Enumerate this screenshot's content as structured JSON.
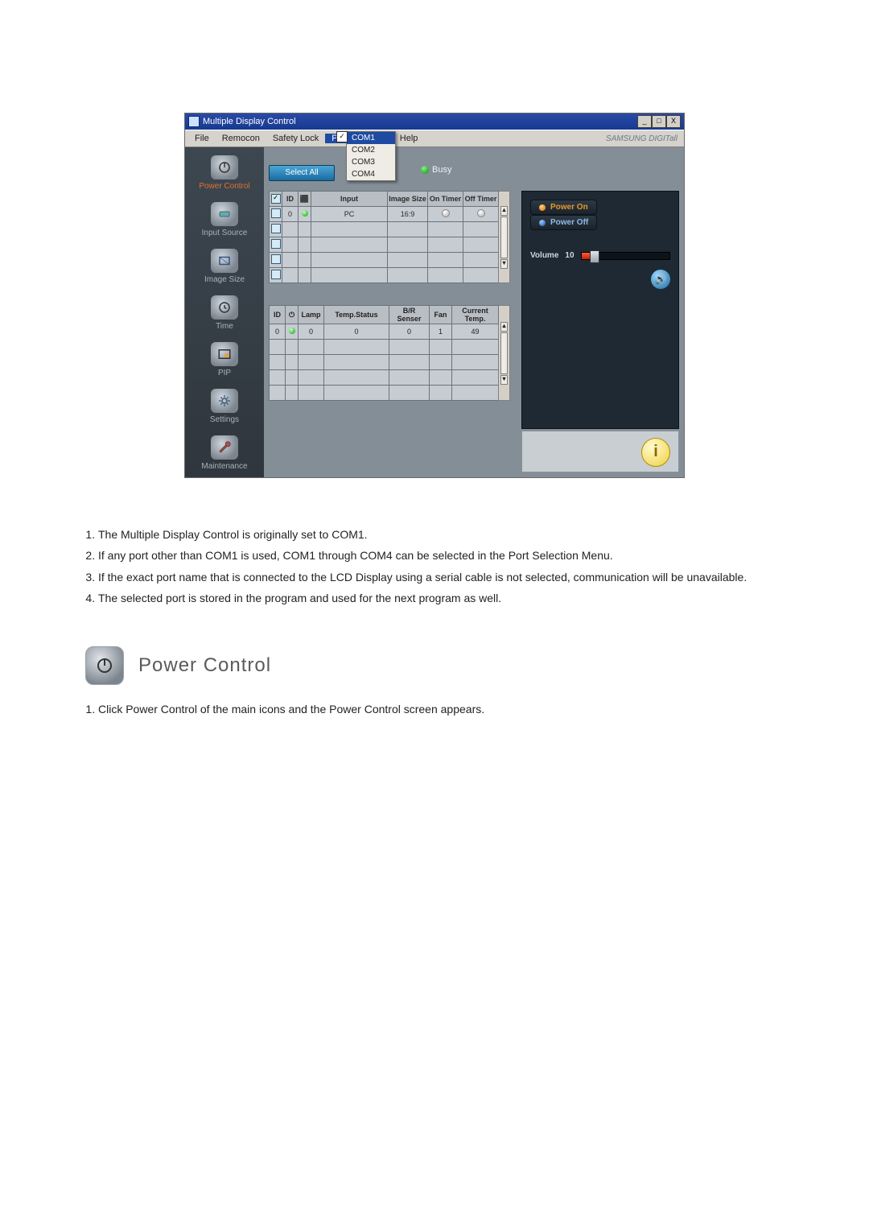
{
  "app": {
    "title": "Multiple Display Control",
    "brand": "SAMSUNG DIGITall",
    "menu": {
      "file": "File",
      "remocon": "Remocon",
      "safety": "Safety Lock",
      "port": "Port Selection",
      "help": "Help"
    },
    "ports": [
      "COM1",
      "COM2",
      "COM3",
      "COM4"
    ],
    "select_all": "Select All",
    "busy": "Busy",
    "sidebar": [
      {
        "label": "Power Control"
      },
      {
        "label": "Input Source"
      },
      {
        "label": "Image Size"
      },
      {
        "label": "Time"
      },
      {
        "label": "PIP"
      },
      {
        "label": "Settings"
      },
      {
        "label": "Maintenance"
      }
    ],
    "grid1": {
      "headers": {
        "id": "ID",
        "input": "Input",
        "imgsize": "Image Size",
        "ontimer": "On Timer",
        "offtimer": "Off Timer"
      },
      "row": {
        "id": "0",
        "input": "PC",
        "imgsize": "16:9"
      }
    },
    "grid2": {
      "headers": {
        "id": "ID",
        "pwr": "",
        "lamp": "Lamp",
        "temp": "Temp.Status",
        "br": "B/R Senser",
        "fan": "Fan",
        "cur": "Current Temp."
      },
      "row": {
        "id": "0",
        "lamp": "0",
        "temp": "0",
        "br": "0",
        "fan": "1",
        "cur": "49"
      }
    },
    "power_on": "Power On",
    "power_off": "Power Off",
    "volume_label": "Volume",
    "volume_value": "10"
  },
  "notes": [
    "The Multiple Display Control is originally set to COM1.",
    "If any port other than COM1 is used, COM1 through COM4 can be selected in the Port Selection Menu.",
    "If the exact port name that is connected to the LCD Display using a serial cable is not selected, communication will be unavailable.",
    "The selected port is stored in the program and used for the next program as well."
  ],
  "section_title": "Power Control",
  "steps": [
    "Click Power Control of the main icons and the Power Control screen appears."
  ]
}
